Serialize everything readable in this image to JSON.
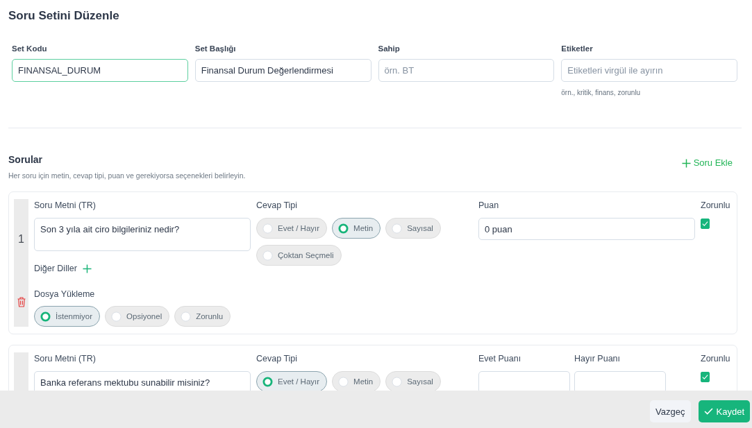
{
  "page": {
    "title": "Soru Setini Düzenle"
  },
  "set_fields": [
    {
      "label": "Set Kodu",
      "value": "FINANSAL_DURUM",
      "focused": true
    },
    {
      "label": "Set Başlığı",
      "value": "Finansal Durum Değerlendirmesi",
      "focused": false
    },
    {
      "label": "Sahip",
      "placeholder": "örn. BT",
      "focused": false
    },
    {
      "label": "Etiketler",
      "placeholder": "Etiketleri virgül ile ayırın",
      "hint": "örn., kritik, finans, zorunlu",
      "focused": false
    }
  ],
  "questions_section": {
    "title": "Sorular",
    "subtitle": "Her soru için metin, cevap tipi, puan ve gerekiyorsa seçenekleri belirleyin.",
    "add_button": "Soru Ekle"
  },
  "questions": [
    {
      "number": "1",
      "text_label": "Soru Metni (TR)",
      "text": "Son 3 yıla ait ciro bilgileriniz nedir?",
      "other_languages": "Diğer Diller",
      "answer_type_label": "Cevap Tipi",
      "answer_types": [
        {
          "label": "Evet / Hayır",
          "selected": false
        },
        {
          "label": "Metin",
          "selected": true
        },
        {
          "label": "Sayısal",
          "selected": false
        },
        {
          "label": "Çoktan Seçmeli",
          "selected": false
        }
      ],
      "scores": [
        {
          "label": "Puan",
          "value": "0 puan"
        }
      ],
      "required_label": "Zorunlu",
      "required": true,
      "file_upload_label": "Dosya Yükleme",
      "file_upload_options": [
        {
          "label": "İstenmiyor",
          "selected": true
        },
        {
          "label": "Opsiyonel",
          "selected": false
        },
        {
          "label": "Zorunlu",
          "selected": false
        }
      ]
    },
    {
      "text_label": "Soru Metni (TR)",
      "text": "Banka referans mektubu sunabilir misiniz?",
      "answer_type_label": "Cevap Tipi",
      "answer_types": [
        {
          "label": "Evet / Hayır",
          "selected": true
        },
        {
          "label": "Metin",
          "selected": false
        },
        {
          "label": "Sayısal",
          "selected": false
        }
      ],
      "scores": [
        {
          "label": "Evet Puanı"
        },
        {
          "label": "Hayır Puanı"
        }
      ],
      "required_label": "Zorunlu",
      "required": true
    }
  ],
  "footer": {
    "cancel_button": "Vazgeç",
    "save_button": "Kaydet"
  }
}
